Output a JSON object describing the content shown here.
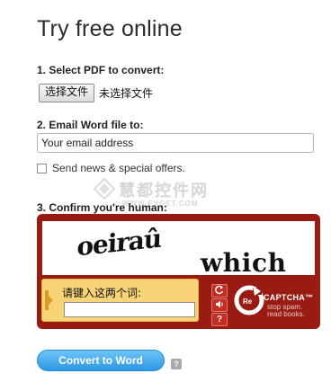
{
  "title": "Try free online",
  "step1": {
    "label": "1. Select PDF to convert:",
    "choose_file_button": "选择文件",
    "file_status": "未选择文件"
  },
  "step2": {
    "label": "2. Email Word file to:",
    "email_placeholder": "Your email address",
    "news_checkbox_label": "Send news & special offers.",
    "news_checked": false
  },
  "step3": {
    "label": "3. Confirm you're human:",
    "captcha": {
      "word1": "oeiraû",
      "word2": "which",
      "prompt": "请键入这两个词:",
      "response_value": "",
      "reload_icon": "reload-icon",
      "audio_icon": "audio-icon",
      "help_icon": "help-icon",
      "brand_prefix": "Re",
      "brand_name": "CAPTCHA™",
      "tagline_line1": "stop spam.",
      "tagline_line2": "read books.",
      "background_color": "#9a1b12"
    }
  },
  "watermark": {
    "text": "慧都控件网",
    "url": "WWW.EVGET.COM"
  },
  "convert_button": "Convert to Word",
  "help_icon_label": "?"
}
